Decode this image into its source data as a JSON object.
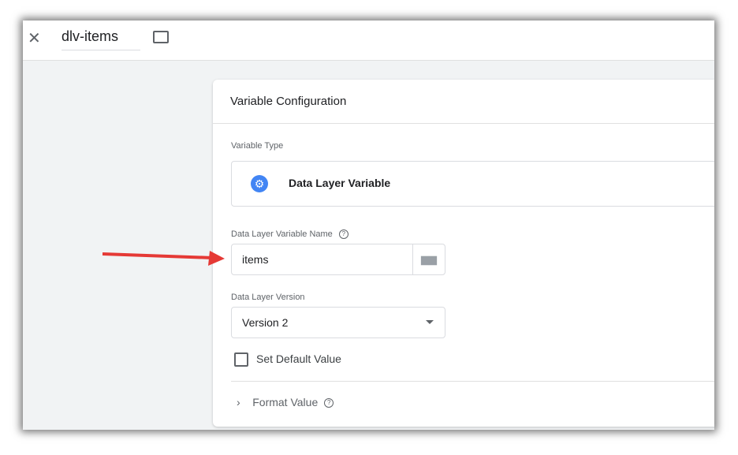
{
  "header": {
    "title": "dlv-items"
  },
  "card": {
    "title": "Variable Configuration",
    "type_label": "Variable Type",
    "type_name": "Data Layer Variable",
    "name_label": "Data Layer Variable Name",
    "name_value": "items",
    "version_label": "Data Layer Version",
    "version_value": "Version 2",
    "default_label": "Set Default Value",
    "default_checked": false,
    "format_label": "Format Value"
  },
  "colors": {
    "accent": "#4285f4",
    "arrow": "#e53935"
  }
}
